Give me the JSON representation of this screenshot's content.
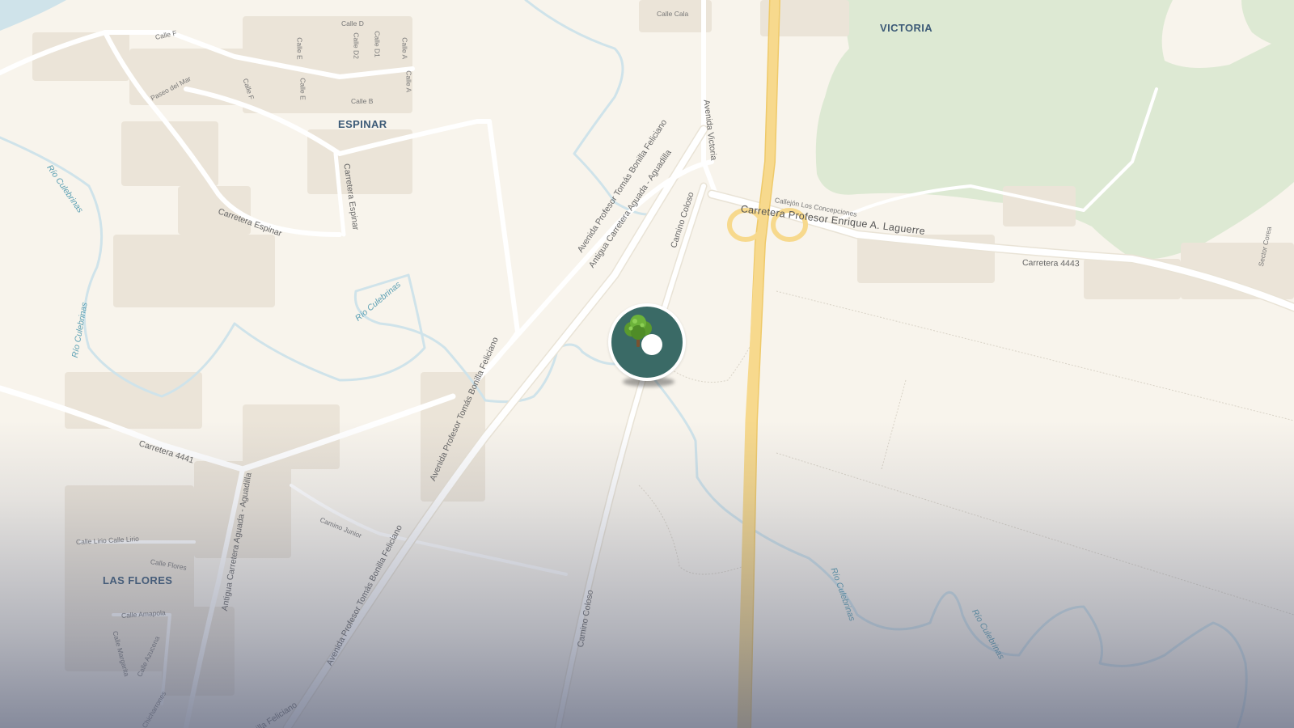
{
  "colors": {
    "background": "#f8f4ec",
    "forest": "#dde9d3",
    "water": "#cfe3ea",
    "highway": "#f7d98d",
    "road": "#ffffff",
    "building": "#ebe4d8",
    "marker": "#3a6a66",
    "place_label": "#3c5a77",
    "river_label": "#5a9fb3"
  },
  "map": {
    "places": {
      "victoria": "VICTORIA",
      "espinar": "ESPINAR",
      "las_flores": "LAS FLORES"
    },
    "roads": {
      "avenida_bonilla_1": "Avenida Profesor Tomás Bonilla Feliciano",
      "avenida_bonilla_2": "Avenida Profesor Tomás Bonilla Feliciano",
      "avenida_bonilla_3": "Avenida Profesor Tomás Bonilla Feliciano",
      "avenida_bonilla_4": "illa Feliciano",
      "antigua_carretera_1": "Antigua Carretera Aguada - Aguadilla",
      "antigua_carretera_2": "Antigua Carretera Aguada - Aguadilla",
      "avenida_victoria": "Avenida Victoria",
      "camino_coloso_1": "Camino Coloso",
      "camino_coloso_2": "Camino Coloso",
      "carretera_laguerre": "Carretera Profesor Enrique A. Laguerre",
      "carretera_4443": "Carretera 4443",
      "carretera_4441": "Carretera 4441",
      "carretera_espinar_1": "Carretera Espinar",
      "carretera_espinar_2": "Carretera Espinar",
      "callejon_concepciones": "Callejón Los Concepciones",
      "camino_junior": "Camino Junior",
      "sector_corea": "Sector Corea"
    },
    "streets": {
      "calle_cala": "Calle Cala",
      "calle_d": "Calle D",
      "calle_d2": "Calle D2",
      "calle_d1": "Calle D1",
      "calle_a_top": "Calle A",
      "calle_a": "Calle A",
      "calle_f_top": "Calle F",
      "calle_e_top": "Calle E",
      "calle_e": "Calle E",
      "calle_f": "Calle F",
      "calle_b": "Calle B",
      "paseo_del_mar": "Paseo del Mar",
      "calle_lirio": "Calle Lirio Calle Lirio",
      "calle_flores": "Calle Flores",
      "calle_amapola": "Calle Amapola",
      "calle_margarita": "Calle Margarita",
      "calle_azucena": "Calle Azucena",
      "chicharrones": "Chicharrones"
    },
    "rivers": {
      "rio_1": "Río Culebrinas",
      "rio_2": "Río Culebrinas",
      "rio_3": "Río Culebrinas",
      "rio_4": "Río Culebrinas",
      "rio_5": "Río Culebrinas"
    }
  },
  "marker": {
    "icon": "tree-icon",
    "color": "#3a6a66"
  }
}
